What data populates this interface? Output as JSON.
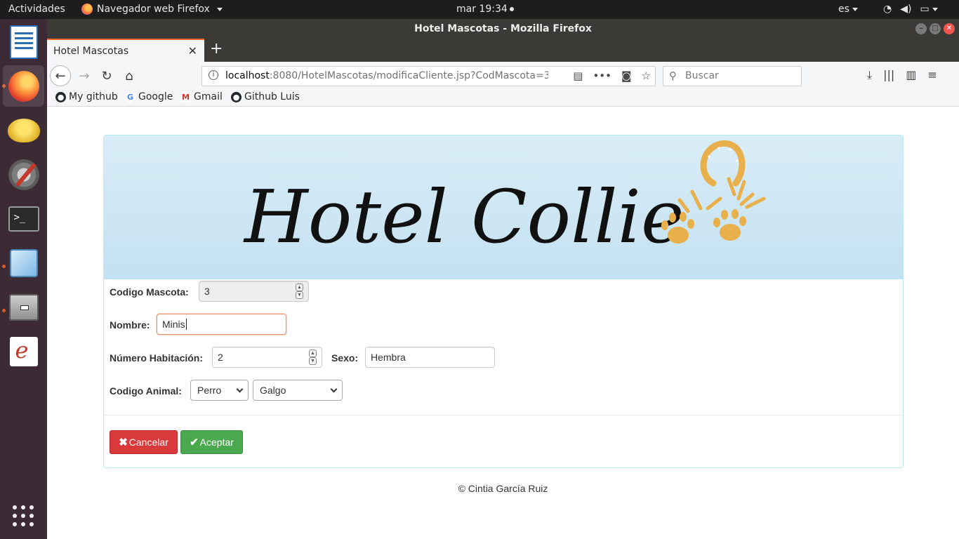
{
  "system_bar": {
    "activities": "Actividades",
    "app_menu": "Navegador web Firefox",
    "clock": "mar 19:34",
    "language": "es"
  },
  "dock": {
    "items": [
      "libreoffice-writer-icon",
      "firefox-icon",
      "lamp-icon",
      "settings-icon",
      "terminal-icon",
      "virtualbox-icon",
      "file-cabinet-icon",
      "document-viewer-icon"
    ],
    "accent_color": "#e95420"
  },
  "window": {
    "title": "Hotel Mascotas - Mozilla Firefox"
  },
  "browser": {
    "tab_title": "Hotel Mascotas",
    "url_host": "localhost",
    "url_rest": ":8080/HotelMascotas/modificaCliente.jsp?CodMascota=3&",
    "search_placeholder": "Buscar",
    "bookmarks": [
      "My github",
      "Google",
      "Gmail",
      "Github Luis"
    ]
  },
  "page": {
    "banner_title": "Hotel Collie",
    "form": {
      "codigo_mascota_label": "Codigo Mascota:",
      "codigo_mascota_value": "3",
      "nombre_label": "Nombre:",
      "nombre_value": "Minis",
      "habitacion_label": "Número Habitación:",
      "habitacion_value": "2",
      "sexo_label": "Sexo:",
      "sexo_value": "Hembra",
      "codigo_animal_label": "Codigo Animal:",
      "especie_selected": "Perro",
      "raza_selected": "Galgo"
    },
    "buttons": {
      "cancel": "Cancelar",
      "accept": "Aceptar"
    },
    "footer": "© Cintia García Ruiz",
    "colors": {
      "banner_bg": "#d9edf7",
      "panel_border": "#bce8f1",
      "danger": "#d9393a",
      "success": "#4aa84e",
      "logo_gold": "#e8b04a"
    }
  }
}
